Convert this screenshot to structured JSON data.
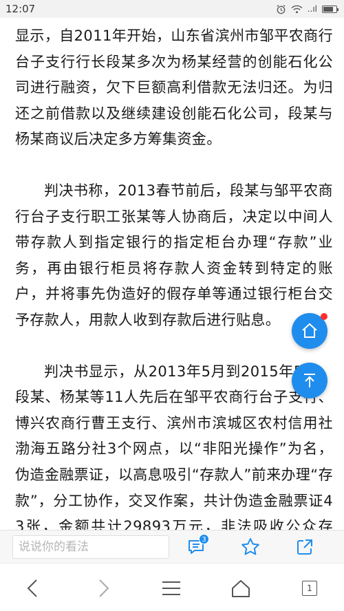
{
  "status_bar": {
    "time": "12:07",
    "signal_label": "..ıl"
  },
  "article": {
    "paragraphs": [
      "显示，自2011年开始，山东省滨州市邹平农商行台子支行行长段某多次为杨某经营的创能石化公司进行融资，欠下巨额高利借款无法归还。为归还之前借款以及继续建设创能石化公司，段某与杨某商议后决定多方筹集资金。",
      "判决书称，2013春节前后，段某与邹平农商行台子支行职工张某等人协商后，决定以中间人带存款人到指定银行的指定柜台办理“存款”业务，再由银行柜员将存款人资金转到特定的账户，并将事先伪造好的假存单等通过银行柜台交予存款人，用款人收到存款后进行贴息。",
      "判决书显示，从2013年5月到2015年5月，段某、杨某等11人先后在邹平农商行台子支行、博兴农商行曹王支行、滨州市滨城区农村信用社渤海五路分社3个网点，以“非阳光操作”为名，伪造金融票证，以高息吸引“存款人”前来办理“存款”，分工协作，交叉作案，共计伪造金融票证43张，金额共计29893万元，非法吸收公众存款。"
    ]
  },
  "comment_bar": {
    "placeholder": "说说你的看法",
    "comment_count": "3"
  },
  "nav_bar": {
    "tab_count": "1"
  },
  "colors": {
    "accent": "#1f8ded",
    "notification_dot": "#ff2d2d"
  }
}
